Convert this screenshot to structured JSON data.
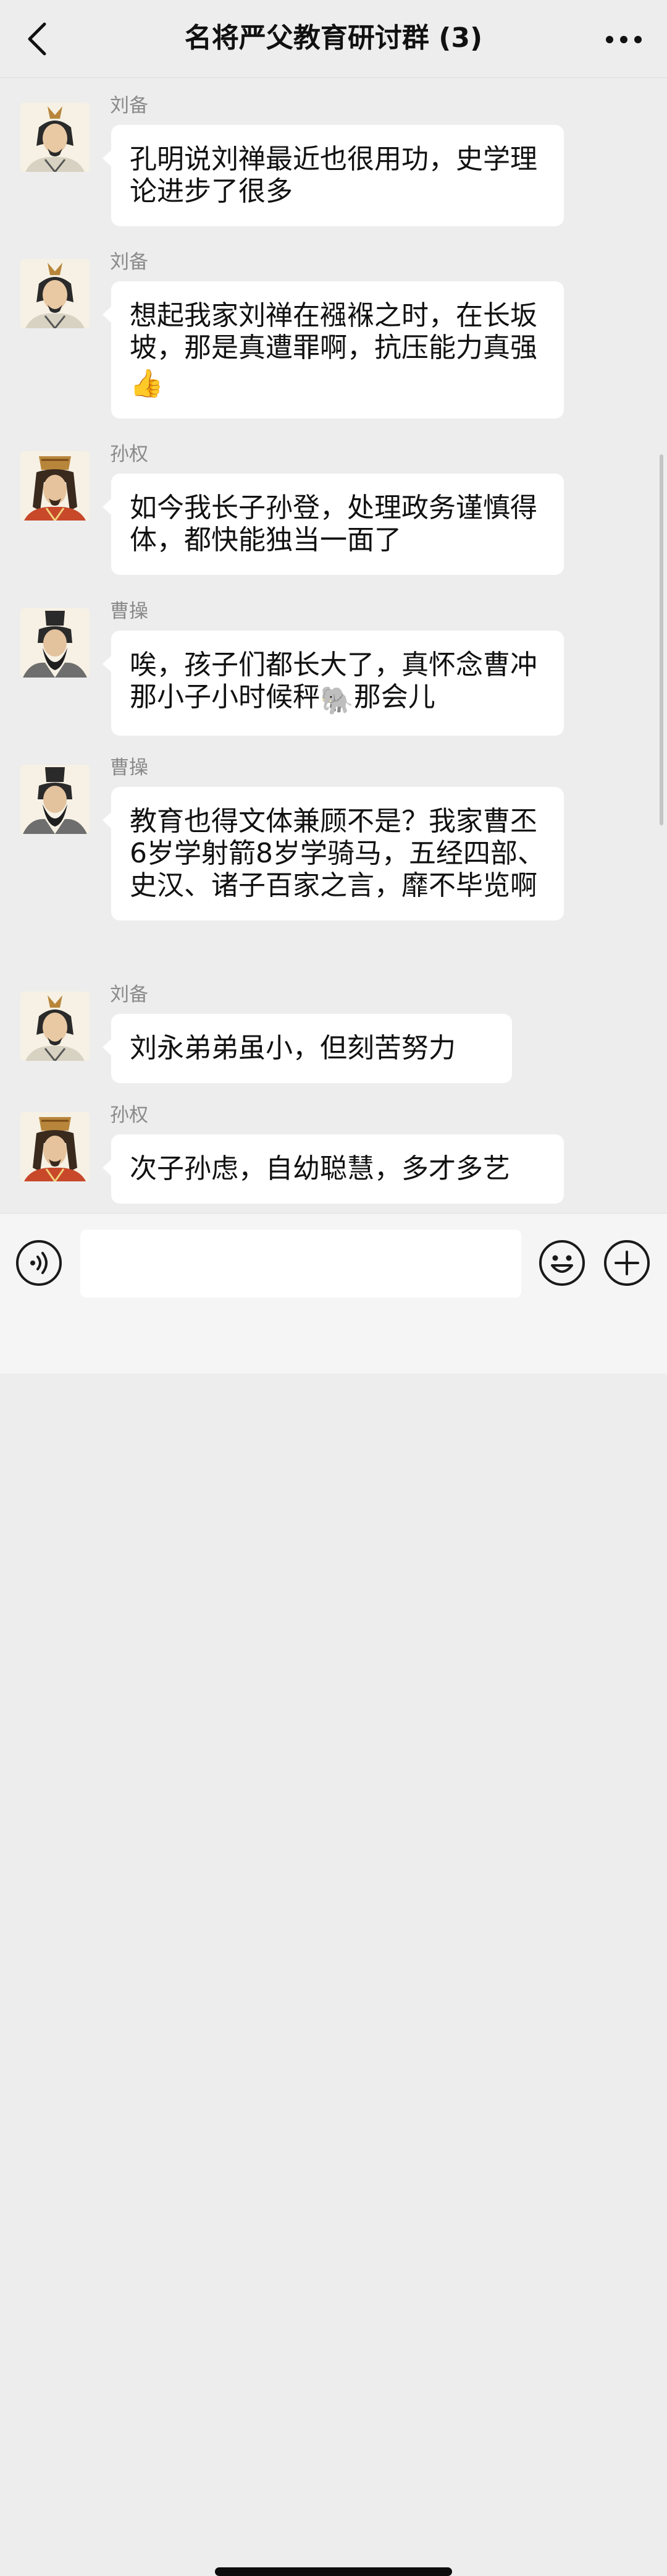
{
  "header": {
    "title": "名将严父教育研讨群 (3)"
  },
  "messages": [
    {
      "sender": "刘备",
      "avatar": "liubei-avatar",
      "text": "孔明说刘禅最近也很用功，史学理论进步了很多"
    },
    {
      "sender": "刘备",
      "avatar": "liubei-avatar",
      "text": "想起我家刘禅在襁褓之时，在长坂坡，那是真遭罪啊，抗压能力真强",
      "emoji": "👍"
    },
    {
      "sender": "孙权",
      "avatar": "sunquan-avatar",
      "text": "如今我长子孙登，处理政务谨慎得体，都快能独当一面了"
    },
    {
      "sender": "曹操",
      "avatar": "caocao-avatar",
      "text_before": "唉，孩子们都长大了，真怀念曹冲那小子小时候秤",
      "emoji": "🐘",
      "text_after": "那会儿"
    },
    {
      "sender": "曹操",
      "avatar": "caocao-avatar",
      "text": "教育也得文体兼顾不是？我家曹丕6岁学射箭8岁学骑马，五经四部、史汉、诸子百家之言，靡不毕览啊"
    },
    {
      "sender": "刘备",
      "avatar": "liubei-avatar",
      "text": "刘永弟弟虽小，但刻苦努力"
    },
    {
      "sender": "孙权",
      "avatar": "sunquan-avatar",
      "text": "次子孙虑，自幼聪慧，多才多艺"
    }
  ],
  "icons": {
    "back": "chevron-left-icon",
    "more": "more-dots-icon",
    "voice": "voice-icon",
    "emoji": "smiley-icon",
    "plus": "plus-icon"
  },
  "colors": {
    "background": "#ededed",
    "bubble": "#ffffff",
    "sender_name": "#8a8a8a"
  }
}
